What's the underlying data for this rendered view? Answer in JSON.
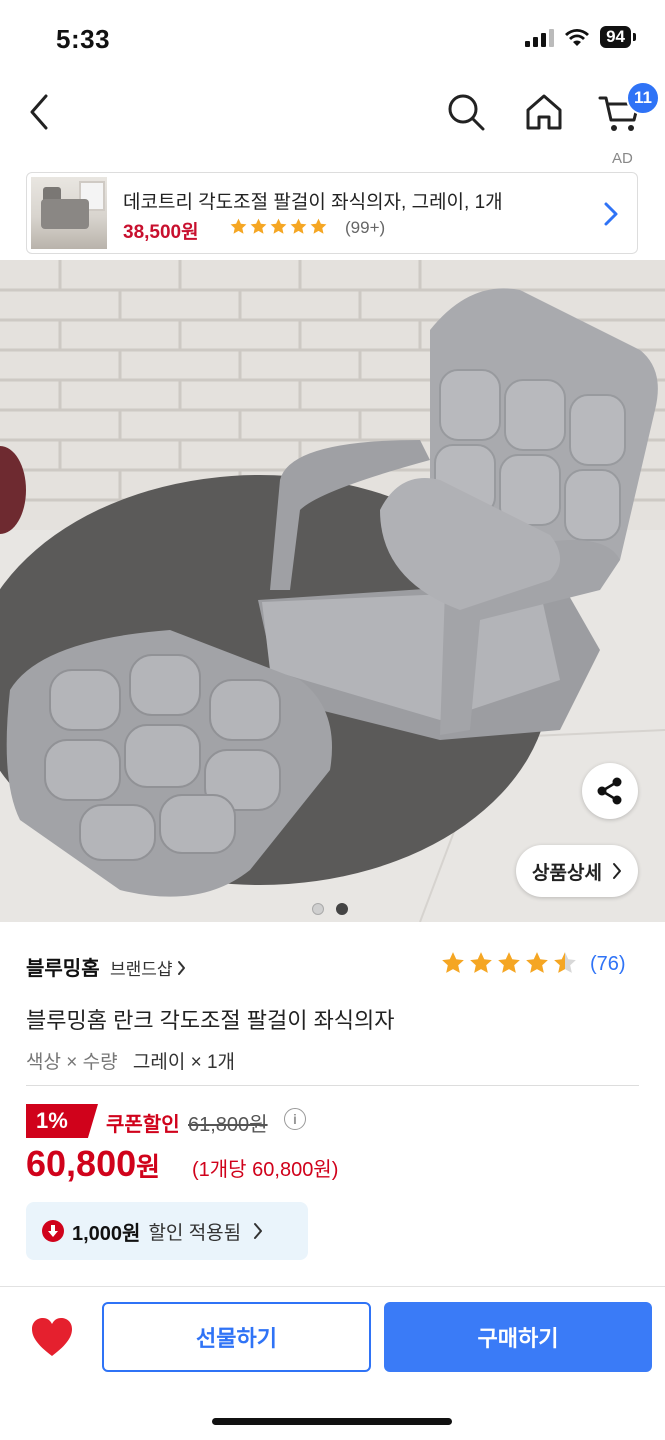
{
  "status": {
    "time": "5:33",
    "battery": "94"
  },
  "nav": {
    "cart_count": "11"
  },
  "ad": {
    "label": "AD",
    "title": "데코트리 각도조절 팔걸이 좌식의자, 그레이, 1개",
    "price": "38,500원",
    "stars": 5,
    "review_count": "(99+)"
  },
  "hero": {
    "detail_button": "상품상세",
    "slide_count": 2,
    "active_slide": 2
  },
  "product": {
    "brand": "블루밍홈",
    "brand_shop": "브랜드샵",
    "rating": 4.5,
    "rating_count": "(76)",
    "title": "블루밍홈 란크 각도조절 팔걸이 좌식의자",
    "option_label": "색상 × 수량",
    "option_value": "그레이 × 1개",
    "discount_percent": "1%",
    "coupon_label": "쿠폰할인",
    "original_price": "61,800원",
    "sale_price": "60,800",
    "sale_price_unit": "원",
    "unit_price": "(1개당 60,800원)",
    "applied_amount": "1,000원",
    "applied_text": "할인 적용됨"
  },
  "bottom": {
    "gift_label": "선물하기",
    "buy_label": "구매하기"
  },
  "colors": {
    "accent": "#3a7bf7",
    "sale": "#d0021b",
    "star": "#f5a623"
  }
}
